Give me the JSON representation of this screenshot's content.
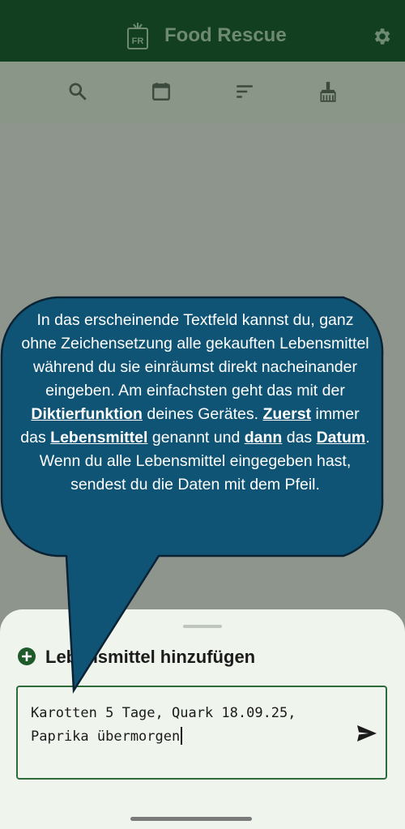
{
  "header": {
    "title": "Food Rescue",
    "logo_text": "FR"
  },
  "toolbar": {
    "icons": [
      "search-icon",
      "calendar-icon",
      "sort-icon",
      "clean-icon"
    ]
  },
  "sheet": {
    "title": "Lebensmittel hinzufügen",
    "input_value": "Karotten 5 Tage, Quark 18.09.25,\nPaprika übermorgen"
  },
  "tooltip": {
    "p1": "In das erscheinende Textfeld kannst du, ganz ohne Zeichensetzung alle gekauften Lebensmittel während du sie einräumst direkt nacheinander eingeben. Am einfachsten geht das mit der ",
    "k1": "Diktierfunktion",
    "p2": " deines Gerätes. ",
    "k2": "Zuerst",
    "p3": " immer  das ",
    "k3": "Lebensmittel",
    "p4": " genannt und ",
    "k4": "dann",
    "p5": " das ",
    "k5": "Datum",
    "p6": ".  Wenn du alle Lebensmittel eingegeben hast, sendest du die Daten mit dem Pfeil."
  },
  "colors": {
    "header_bg": "#123f1f",
    "tooltip_bg": "#0f5474",
    "accent": "#2e6b3a"
  }
}
